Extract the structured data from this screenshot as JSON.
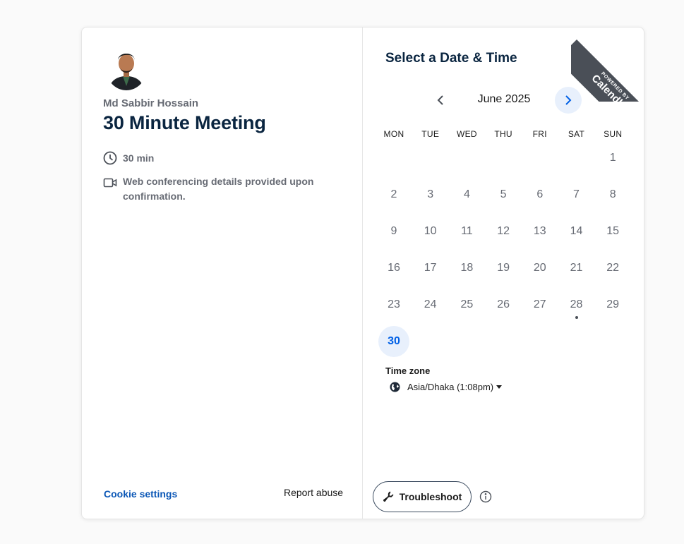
{
  "host": {
    "name": "Md Sabbir Hossain"
  },
  "event": {
    "title": "30 Minute Meeting",
    "duration": "30 min",
    "conferencing": "Web conferencing details provided upon confirmation."
  },
  "footer": {
    "cookie_settings": "Cookie settings",
    "report_abuse": "Report abuse"
  },
  "scheduler": {
    "title": "Select a Date & Time",
    "month": "June 2025",
    "weekdays": [
      "MON",
      "TUE",
      "WED",
      "THU",
      "FRI",
      "SAT",
      "SUN"
    ],
    "weeks": [
      [
        "",
        "",
        "",
        "",
        "",
        "",
        "1"
      ],
      [
        "2",
        "3",
        "4",
        "5",
        "6",
        "7",
        "8"
      ],
      [
        "9",
        "10",
        "11",
        "12",
        "13",
        "14",
        "15"
      ],
      [
        "16",
        "17",
        "18",
        "19",
        "20",
        "21",
        "22"
      ],
      [
        "23",
        "24",
        "25",
        "26",
        "27",
        "28",
        "29"
      ],
      [
        "30",
        "",
        "",
        "",
        "",
        "",
        ""
      ]
    ],
    "available_days": [
      "30"
    ],
    "today": "28",
    "timezone_label": "Time zone",
    "timezone_value": "Asia/Dhaka (1:08pm)"
  },
  "badge": {
    "line1": "POWERED BY",
    "line2": "Calendly"
  },
  "troubleshoot": {
    "label": "Troubleshoot"
  },
  "colors": {
    "accent": "#0060e6",
    "accent_bg": "#e8f0fc",
    "link": "#0b57b6",
    "heading": "#0a2540",
    "muted": "#666a73"
  }
}
